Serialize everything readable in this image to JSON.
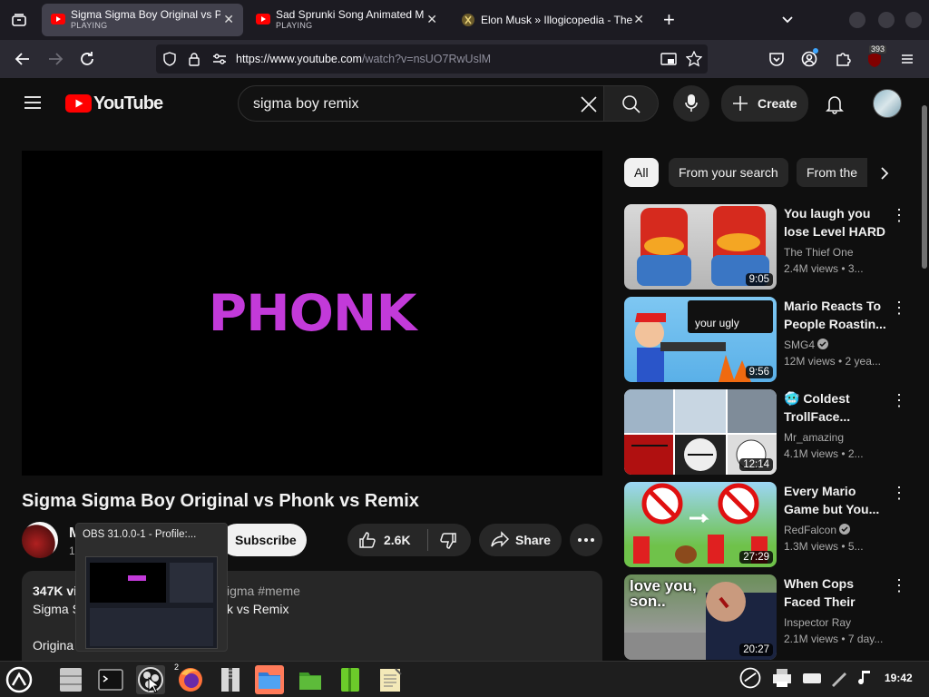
{
  "browser": {
    "tabs": [
      {
        "title": "Sigma Sigma Boy Original vs P",
        "status": "PLAYING",
        "close": "✕"
      },
      {
        "title": "Sad Sprunki Song Animated M",
        "status": "PLAYING",
        "close": "✕"
      },
      {
        "title": "Elon Musk » Illogicopedia - The",
        "status": "",
        "close": "✕"
      }
    ],
    "new_tab": "+",
    "url_prefix": "https://www.youtube.com",
    "url_path": "/watch?v=nsUO7RwUslM",
    "extension_badge": "393"
  },
  "youtube": {
    "logo_text": "YouTube",
    "search_value": "sigma boy remix",
    "create_label": "Create",
    "video": {
      "overlay_text": "PHONK",
      "title": "Sigma Sigma Boy Original vs Phonk vs Remix",
      "channel_initial": "M",
      "channel_sub_initial": "1",
      "subscribe_label": "Subscribe",
      "likes": "2.6K",
      "share_label": "Share",
      "description": {
        "views_partial": "347K vi",
        "tags_partial": "igma #meme",
        "line2_start": "Sigma S",
        "line2_end": "k vs Remix",
        "line3": "Origina"
      }
    },
    "chips": [
      "All",
      "From your search",
      "From the"
    ],
    "recommendations": [
      {
        "title": "You laugh you lose Level HARD",
        "channel": "The Thief One",
        "verified": false,
        "meta": "2.4M views  • 3...",
        "duration": "9:05",
        "thumb_text": ""
      },
      {
        "title": "Mario Reacts To People Roastin...",
        "channel": "SMG4",
        "verified": true,
        "meta": "12M views  • 2 yea...",
        "duration": "9:56",
        "thumb_text": "your ugly"
      },
      {
        "title": "🥶 Coldest TrollFace...",
        "channel": "Mr_amazing",
        "verified": false,
        "meta": "4.1M views  • 2...",
        "duration": "12:14",
        "thumb_text": ""
      },
      {
        "title": "Every Mario Game but You...",
        "channel": "RedFalcon",
        "verified": true,
        "meta": "1.3M views  • 5...",
        "duration": "27:29",
        "thumb_text": ""
      },
      {
        "title": "When Cops Faced Their Las...",
        "channel": "Inspector Ray",
        "verified": false,
        "meta": "2.1M views  • 7 day...",
        "duration": "20:27",
        "thumb_text": "love you, son.."
      }
    ]
  },
  "obs_preview": {
    "title": "OBS 31.0.0-1 - Profile:..."
  },
  "taskbar": {
    "clock": "19:42",
    "firefox_badge": "2"
  },
  "colors": {
    "youtube_red": "#ff0000",
    "phonk_magenta": "#c23ad9",
    "accent_blue": "#3ea6ff"
  }
}
